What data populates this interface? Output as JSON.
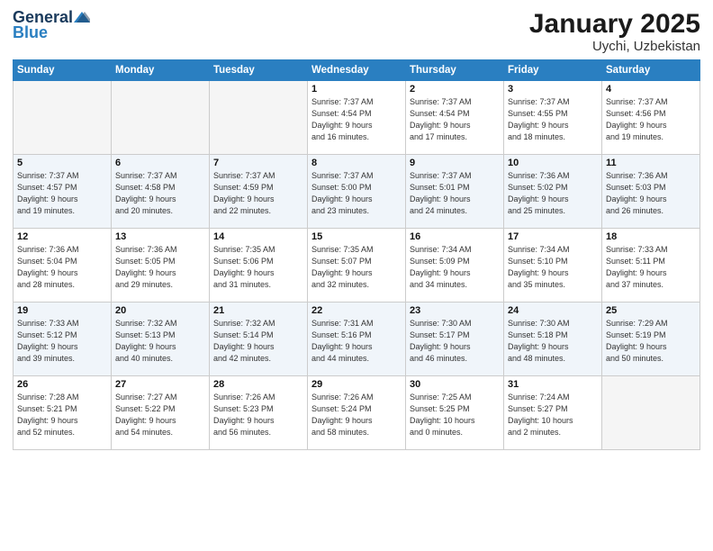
{
  "header": {
    "logo_general": "General",
    "logo_blue": "Blue",
    "title": "January 2025",
    "subtitle": "Uychi, Uzbekistan"
  },
  "days_of_week": [
    "Sunday",
    "Monday",
    "Tuesday",
    "Wednesday",
    "Thursday",
    "Friday",
    "Saturday"
  ],
  "weeks": [
    [
      {
        "num": "",
        "info": ""
      },
      {
        "num": "",
        "info": ""
      },
      {
        "num": "",
        "info": ""
      },
      {
        "num": "1",
        "info": "Sunrise: 7:37 AM\nSunset: 4:54 PM\nDaylight: 9 hours\nand 16 minutes."
      },
      {
        "num": "2",
        "info": "Sunrise: 7:37 AM\nSunset: 4:54 PM\nDaylight: 9 hours\nand 17 minutes."
      },
      {
        "num": "3",
        "info": "Sunrise: 7:37 AM\nSunset: 4:55 PM\nDaylight: 9 hours\nand 18 minutes."
      },
      {
        "num": "4",
        "info": "Sunrise: 7:37 AM\nSunset: 4:56 PM\nDaylight: 9 hours\nand 19 minutes."
      }
    ],
    [
      {
        "num": "5",
        "info": "Sunrise: 7:37 AM\nSunset: 4:57 PM\nDaylight: 9 hours\nand 19 minutes."
      },
      {
        "num": "6",
        "info": "Sunrise: 7:37 AM\nSunset: 4:58 PM\nDaylight: 9 hours\nand 20 minutes."
      },
      {
        "num": "7",
        "info": "Sunrise: 7:37 AM\nSunset: 4:59 PM\nDaylight: 9 hours\nand 22 minutes."
      },
      {
        "num": "8",
        "info": "Sunrise: 7:37 AM\nSunset: 5:00 PM\nDaylight: 9 hours\nand 23 minutes."
      },
      {
        "num": "9",
        "info": "Sunrise: 7:37 AM\nSunset: 5:01 PM\nDaylight: 9 hours\nand 24 minutes."
      },
      {
        "num": "10",
        "info": "Sunrise: 7:36 AM\nSunset: 5:02 PM\nDaylight: 9 hours\nand 25 minutes."
      },
      {
        "num": "11",
        "info": "Sunrise: 7:36 AM\nSunset: 5:03 PM\nDaylight: 9 hours\nand 26 minutes."
      }
    ],
    [
      {
        "num": "12",
        "info": "Sunrise: 7:36 AM\nSunset: 5:04 PM\nDaylight: 9 hours\nand 28 minutes."
      },
      {
        "num": "13",
        "info": "Sunrise: 7:36 AM\nSunset: 5:05 PM\nDaylight: 9 hours\nand 29 minutes."
      },
      {
        "num": "14",
        "info": "Sunrise: 7:35 AM\nSunset: 5:06 PM\nDaylight: 9 hours\nand 31 minutes."
      },
      {
        "num": "15",
        "info": "Sunrise: 7:35 AM\nSunset: 5:07 PM\nDaylight: 9 hours\nand 32 minutes."
      },
      {
        "num": "16",
        "info": "Sunrise: 7:34 AM\nSunset: 5:09 PM\nDaylight: 9 hours\nand 34 minutes."
      },
      {
        "num": "17",
        "info": "Sunrise: 7:34 AM\nSunset: 5:10 PM\nDaylight: 9 hours\nand 35 minutes."
      },
      {
        "num": "18",
        "info": "Sunrise: 7:33 AM\nSunset: 5:11 PM\nDaylight: 9 hours\nand 37 minutes."
      }
    ],
    [
      {
        "num": "19",
        "info": "Sunrise: 7:33 AM\nSunset: 5:12 PM\nDaylight: 9 hours\nand 39 minutes."
      },
      {
        "num": "20",
        "info": "Sunrise: 7:32 AM\nSunset: 5:13 PM\nDaylight: 9 hours\nand 40 minutes."
      },
      {
        "num": "21",
        "info": "Sunrise: 7:32 AM\nSunset: 5:14 PM\nDaylight: 9 hours\nand 42 minutes."
      },
      {
        "num": "22",
        "info": "Sunrise: 7:31 AM\nSunset: 5:16 PM\nDaylight: 9 hours\nand 44 minutes."
      },
      {
        "num": "23",
        "info": "Sunrise: 7:30 AM\nSunset: 5:17 PM\nDaylight: 9 hours\nand 46 minutes."
      },
      {
        "num": "24",
        "info": "Sunrise: 7:30 AM\nSunset: 5:18 PM\nDaylight: 9 hours\nand 48 minutes."
      },
      {
        "num": "25",
        "info": "Sunrise: 7:29 AM\nSunset: 5:19 PM\nDaylight: 9 hours\nand 50 minutes."
      }
    ],
    [
      {
        "num": "26",
        "info": "Sunrise: 7:28 AM\nSunset: 5:21 PM\nDaylight: 9 hours\nand 52 minutes."
      },
      {
        "num": "27",
        "info": "Sunrise: 7:27 AM\nSunset: 5:22 PM\nDaylight: 9 hours\nand 54 minutes."
      },
      {
        "num": "28",
        "info": "Sunrise: 7:26 AM\nSunset: 5:23 PM\nDaylight: 9 hours\nand 56 minutes."
      },
      {
        "num": "29",
        "info": "Sunrise: 7:26 AM\nSunset: 5:24 PM\nDaylight: 9 hours\nand 58 minutes."
      },
      {
        "num": "30",
        "info": "Sunrise: 7:25 AM\nSunset: 5:25 PM\nDaylight: 10 hours\nand 0 minutes."
      },
      {
        "num": "31",
        "info": "Sunrise: 7:24 AM\nSunset: 5:27 PM\nDaylight: 10 hours\nand 2 minutes."
      },
      {
        "num": "",
        "info": ""
      }
    ]
  ]
}
